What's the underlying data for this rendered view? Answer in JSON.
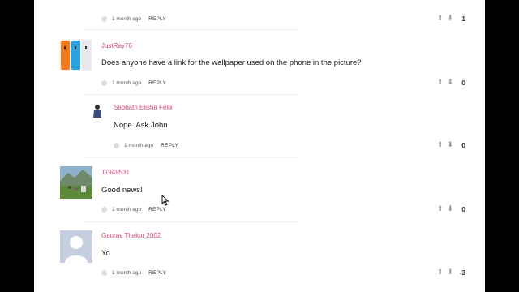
{
  "comments": [
    {
      "username": "",
      "text": "",
      "time": "1 month ago",
      "reply_label": "REPLY",
      "score": "1"
    },
    {
      "username": "JustRay76",
      "text": "Does anyone have a link for the wallpaper used on the phone in the picture?",
      "time": "1 month ago",
      "reply_label": "REPLY",
      "score": "0"
    },
    {
      "username": "Sabbath Elisha Felix",
      "text": "Nope. Ask John",
      "time": "1 month ago",
      "reply_label": "REPLY",
      "score": "0"
    },
    {
      "username": "11949531",
      "text": "Good news!",
      "time": "1 month ago",
      "reply_label": "REPLY",
      "score": "0"
    },
    {
      "username": "Gaurav Thakur 2002",
      "text": "Yo",
      "time": "1 month ago",
      "reply_label": "REPLY",
      "score": "-3"
    }
  ],
  "icons": {
    "upvote": "upvote-arrow-icon",
    "downvote": "downvote-arrow-icon",
    "timestamp": "clock-dot-icon"
  },
  "colors": {
    "username": "#d04a7a",
    "text": "#222222",
    "background": "#ffffff",
    "frame": "#000000"
  }
}
